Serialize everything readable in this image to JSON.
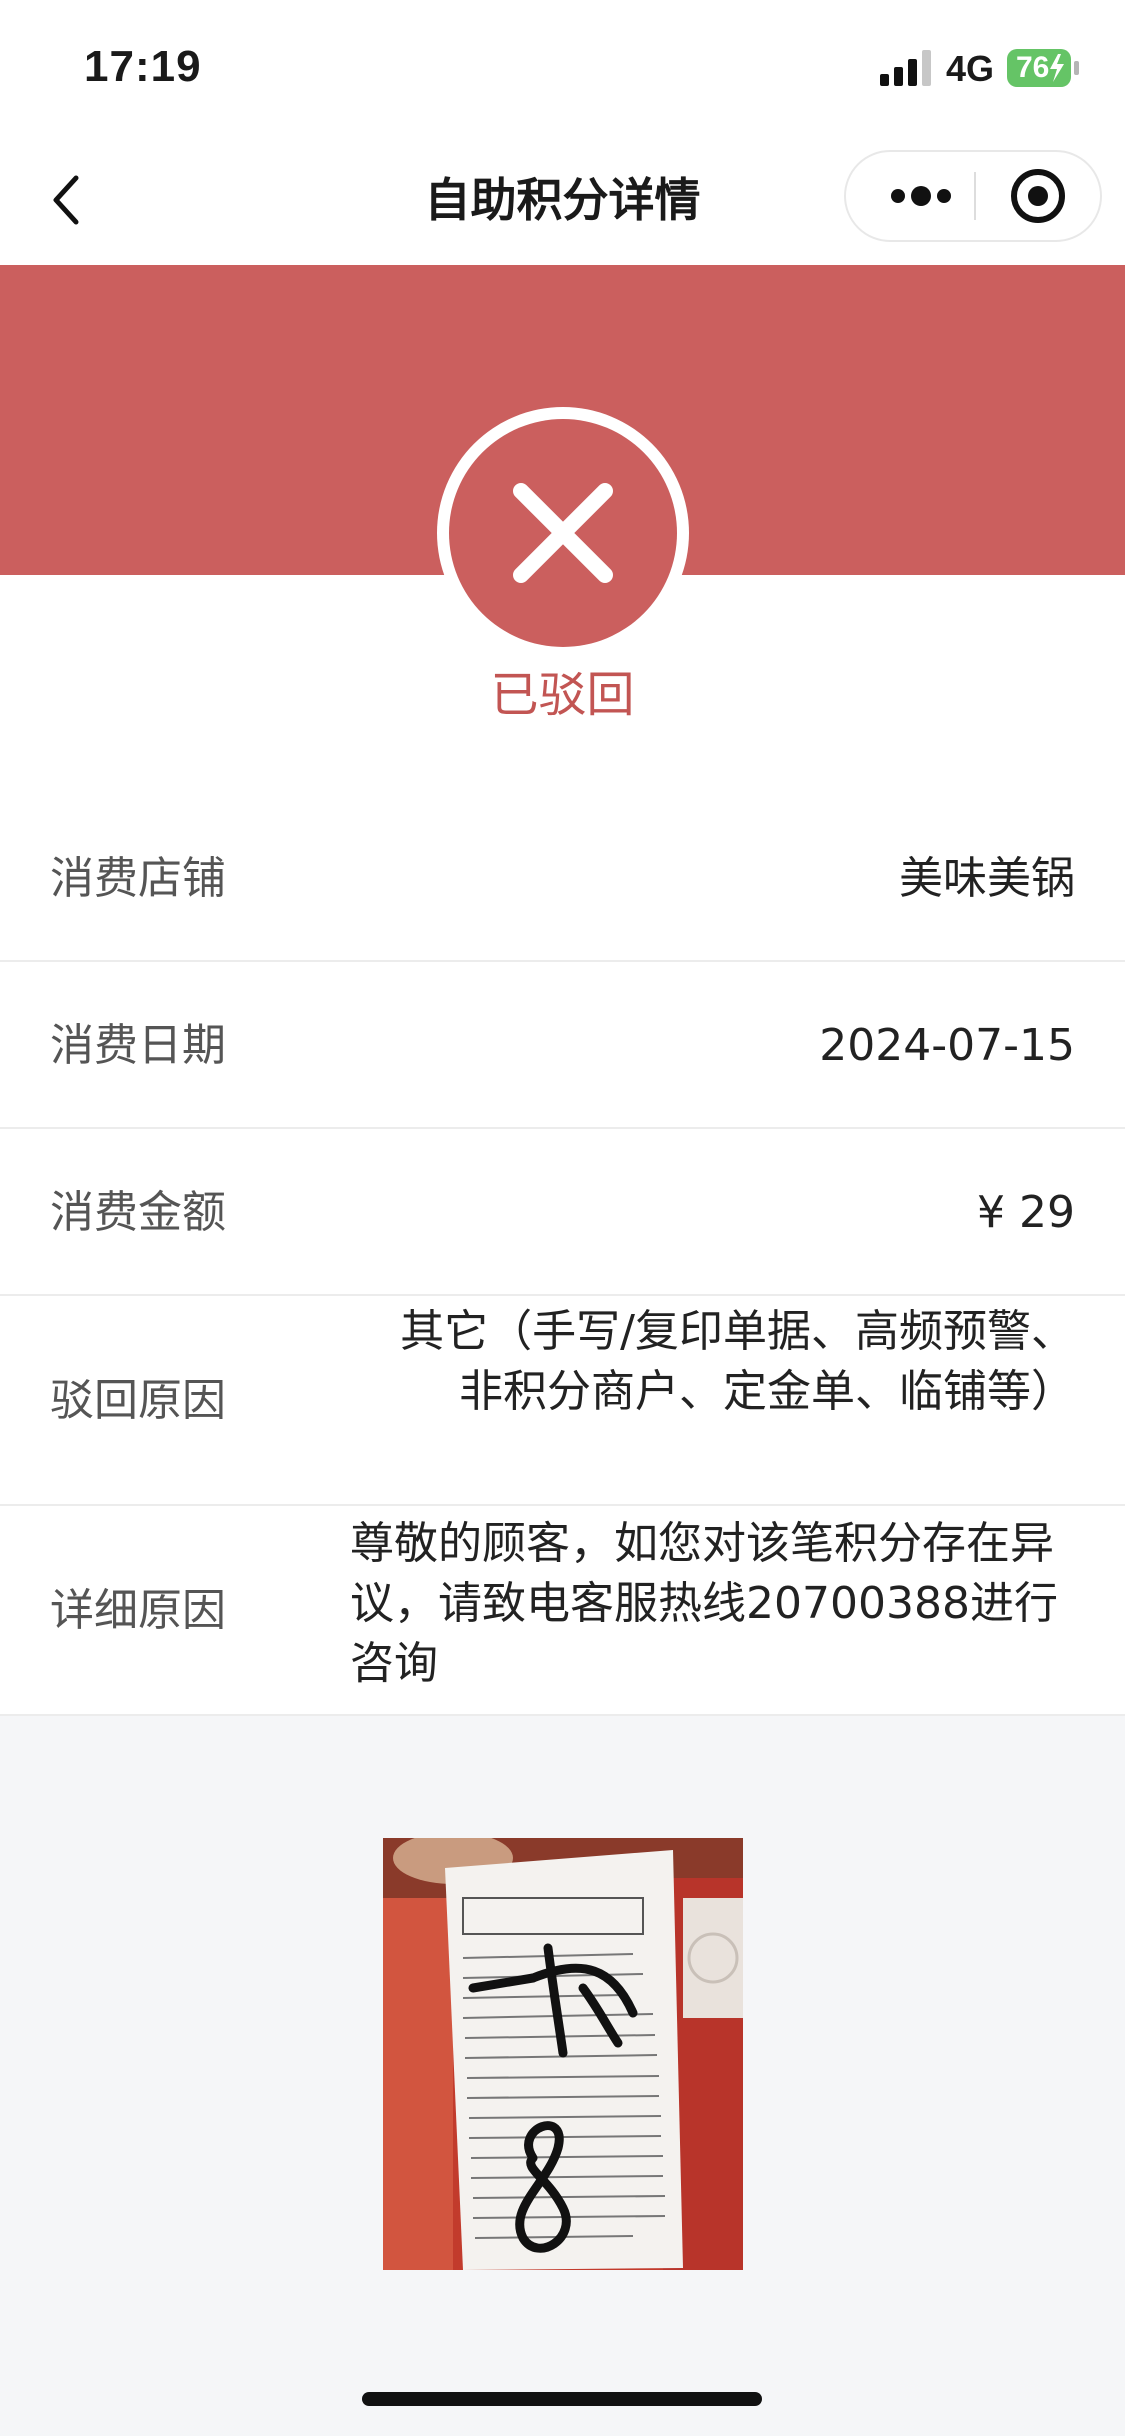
{
  "status_bar": {
    "time": "17:19",
    "network": "4G",
    "battery": "76"
  },
  "nav": {
    "title": "自助积分详情",
    "back_icon": "chevron-left-icon",
    "more_icon": "more-dots-icon",
    "close_icon": "target-close-icon"
  },
  "status": {
    "icon": "x-icon",
    "label": "已驳回",
    "color": "#cb5f5e"
  },
  "details": {
    "store_label": "消费店铺",
    "store_value": "美味美锅",
    "date_label": "消费日期",
    "date_value": "2024-07-15",
    "amount_label": "消费金额",
    "amount_value": "¥ 29",
    "reason_label": "驳回原因",
    "reason_value": "其它（手写/复印单据、高频预警、非积分商户、定金单、临铺等）",
    "detail_label": "详细原因",
    "detail_value": "尊敬的顾客，如您对该笔积分存在异议，请致电客服热线20700388进行咨询"
  },
  "receipt": {
    "image": "receipt-photo",
    "handwriting_1": "一级",
    "handwriting_2": "8"
  }
}
